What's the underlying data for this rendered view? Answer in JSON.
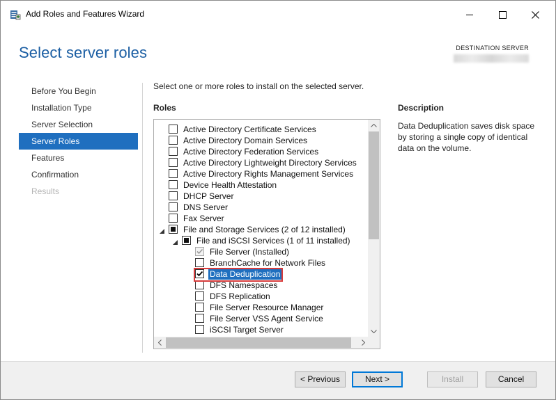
{
  "window": {
    "title": "Add Roles and Features Wizard",
    "controls": {
      "minimize": "minimize-icon",
      "maximize": "maximize-icon",
      "close": "close-icon"
    }
  },
  "header": {
    "page_title": "Select server roles",
    "destination_label": "DESTINATION SERVER",
    "destination_value_redacted": true
  },
  "nav": {
    "items": [
      {
        "label": "Before You Begin",
        "state": "normal"
      },
      {
        "label": "Installation Type",
        "state": "normal"
      },
      {
        "label": "Server Selection",
        "state": "normal"
      },
      {
        "label": "Server Roles",
        "state": "active"
      },
      {
        "label": "Features",
        "state": "normal"
      },
      {
        "label": "Confirmation",
        "state": "normal"
      },
      {
        "label": "Results",
        "state": "disabled"
      }
    ]
  },
  "main": {
    "intro": "Select one or more roles to install on the selected server.",
    "roles_heading": "Roles",
    "description_heading": "Description",
    "description_text": "Data Deduplication saves disk space by storing a single copy of identical data on the volume.",
    "roles": [
      {
        "label": "Active Directory Certificate Services",
        "level": 0,
        "checkbox": "unchecked",
        "expander": "none"
      },
      {
        "label": "Active Directory Domain Services",
        "level": 0,
        "checkbox": "unchecked",
        "expander": "none"
      },
      {
        "label": "Active Directory Federation Services",
        "level": 0,
        "checkbox": "unchecked",
        "expander": "none"
      },
      {
        "label": "Active Directory Lightweight Directory Services",
        "level": 0,
        "checkbox": "unchecked",
        "expander": "none"
      },
      {
        "label": "Active Directory Rights Management Services",
        "level": 0,
        "checkbox": "unchecked",
        "expander": "none"
      },
      {
        "label": "Device Health Attestation",
        "level": 0,
        "checkbox": "unchecked",
        "expander": "none"
      },
      {
        "label": "DHCP Server",
        "level": 0,
        "checkbox": "unchecked",
        "expander": "none"
      },
      {
        "label": "DNS Server",
        "level": 0,
        "checkbox": "unchecked",
        "expander": "none"
      },
      {
        "label": "Fax Server",
        "level": 0,
        "checkbox": "unchecked",
        "expander": "none"
      },
      {
        "label": "File and Storage Services (2 of 12 installed)",
        "level": 0,
        "checkbox": "partial",
        "expander": "expanded"
      },
      {
        "label": "File and iSCSI Services (1 of 11 installed)",
        "level": 1,
        "checkbox": "partial",
        "expander": "expanded"
      },
      {
        "label": "File Server (Installed)",
        "level": 2,
        "checkbox": "checked-disabled",
        "expander": "none"
      },
      {
        "label": "BranchCache for Network Files",
        "level": 2,
        "checkbox": "unchecked",
        "expander": "none"
      },
      {
        "label": "Data Deduplication",
        "level": 2,
        "checkbox": "checked",
        "expander": "none",
        "selected": true
      },
      {
        "label": "DFS Namespaces",
        "level": 2,
        "checkbox": "unchecked",
        "expander": "none"
      },
      {
        "label": "DFS Replication",
        "level": 2,
        "checkbox": "unchecked",
        "expander": "none"
      },
      {
        "label": "File Server Resource Manager",
        "level": 2,
        "checkbox": "unchecked",
        "expander": "none"
      },
      {
        "label": "File Server VSS Agent Service",
        "level": 2,
        "checkbox": "unchecked",
        "expander": "none"
      },
      {
        "label": "iSCSI Target Server",
        "level": 2,
        "checkbox": "unchecked",
        "expander": "none"
      }
    ]
  },
  "footer": {
    "previous_label": "< Previous",
    "next_label": "Next >",
    "install_label": "Install",
    "cancel_label": "Cancel"
  },
  "colors": {
    "accent": "#1f6fbf",
    "title_blue": "#1b5ea3",
    "highlight_border": "#d83b3b"
  }
}
